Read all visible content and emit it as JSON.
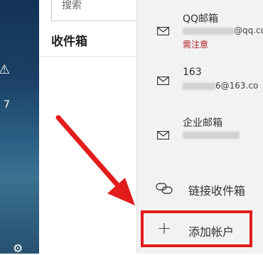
{
  "rail": {
    "warning_icon": "warning-icon",
    "count": "7",
    "settings_icon": "gear-icon"
  },
  "middle": {
    "search_placeholder": "搜索",
    "folder_title": "收件箱"
  },
  "accounts": [
    {
      "name": "QQ邮箱",
      "address_suffix": "@qq.co",
      "status": "需注意",
      "icon": "mail-icon"
    },
    {
      "name": "163",
      "address_suffix": "6@163.co",
      "status": "",
      "icon": "mail-icon"
    },
    {
      "name": "企业邮箱",
      "address_suffix": "",
      "status": "",
      "icon": "mail-icon"
    }
  ],
  "actions": {
    "link_inbox_label": "链接收件箱",
    "add_account_label": "添加帐户"
  },
  "colors": {
    "highlight": "#e31c1c",
    "status_warning": "#b22222",
    "rail": "#1b3f64"
  }
}
